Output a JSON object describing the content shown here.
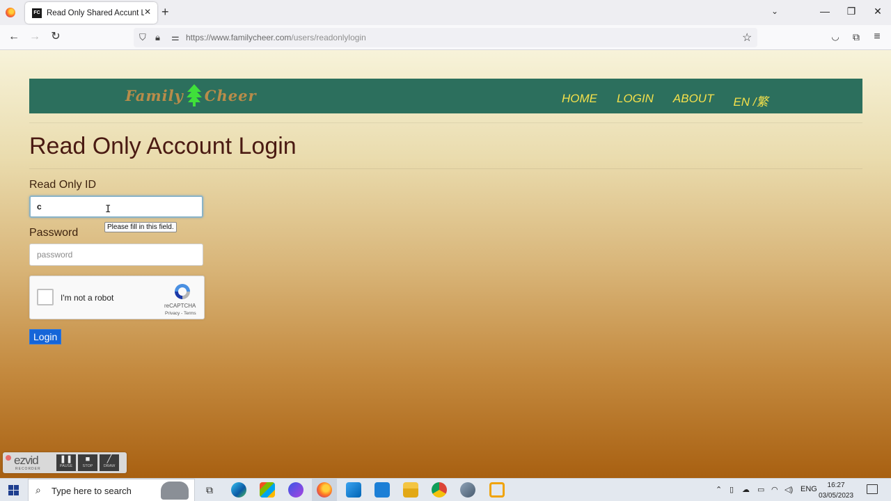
{
  "browser": {
    "tab_title": "Read Only Shared Accunt Login",
    "tab_favicon_text": "FC",
    "new_tab_glyph": "+",
    "url_domain": "https://www.familycheer.com",
    "url_path": "/users/readonlylogin"
  },
  "site": {
    "logo_left": "Family",
    "logo_right": "Cheer",
    "nav": [
      "HOME",
      "LOGIN",
      "ABOUT",
      "EN /繁"
    ],
    "header_color": "#2c6f5d",
    "nav_color": "#f5e04b"
  },
  "form": {
    "title": "Read Only Account Login",
    "id_label": "Read Only ID",
    "id_value": "c",
    "validation_tooltip": "Please fill in this field.",
    "password_label": "Password",
    "password_placeholder": "password",
    "recaptcha_label": "I'm not a robot",
    "recaptcha_brand": "reCAPTCHA",
    "recaptcha_links": "Privacy - Terms",
    "login_button": "Login"
  },
  "overlay": {
    "ezvid_name": "ezvid",
    "ezvid_sub": "RECORDER",
    "buttons": [
      "PAUSE",
      "STOP",
      "DRAW"
    ]
  },
  "taskbar": {
    "search_placeholder": "Type here to search",
    "language": "ENG",
    "time": "16:27",
    "date": "03/05/2023",
    "apps": [
      "task-view",
      "edge",
      "store",
      "copilot-app",
      "firefox",
      "vscode",
      "mail",
      "file-explorer",
      "chrome",
      "app-icon",
      "vmware"
    ]
  }
}
